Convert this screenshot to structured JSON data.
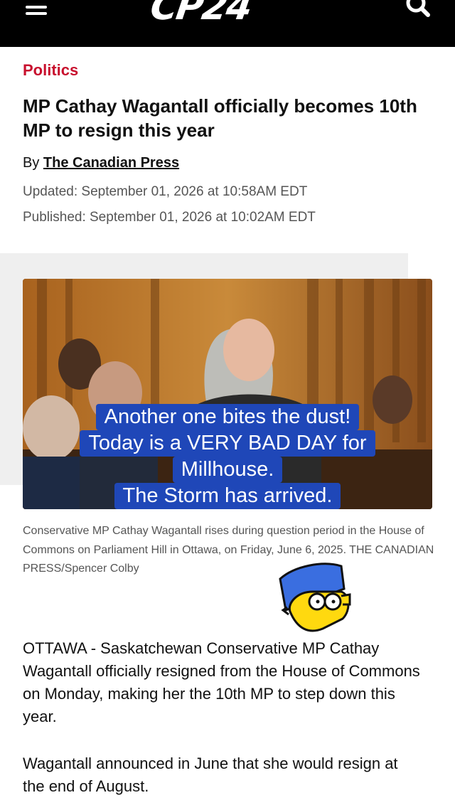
{
  "header": {
    "logo": "CP24",
    "menu_icon": "hamburger-menu-icon",
    "search_icon": "search-icon",
    "background": "#000000"
  },
  "article": {
    "category": "Politics",
    "category_color": "#c8102e",
    "headline": "MP Cathay Wagantall officially becomes 10th MP to resign this year",
    "byline_prefix": "By",
    "author": "The Canadian Press",
    "updated": "Updated: September 01, 2026 at 10:58AM EDT",
    "published": "Published: September 01, 2026 at 10:02AM EDT",
    "image_overlay": {
      "lines": [
        "Another one bites the dust!",
        "Today is a VERY BAD DAY for",
        "Millhouse.",
        "The Storm has arrived."
      ],
      "background": "#1f47b8"
    },
    "image_caption": "Conservative MP Cathay Wagantall rises during question period in the House of Commons on Parliament Hill in Ottawa, on Friday, June 6, 2025. THE CANADIAN PRESS/Spencer Colby",
    "paragraphs": [
      "OTTAWA - Saskatchewan Conservative MP Cathay Wagantall officially resigned from the House of Commons on Monday, making her the 10th MP to step down this year.",
      "Wagantall announced in June that she would resign at the end of August."
    ]
  }
}
